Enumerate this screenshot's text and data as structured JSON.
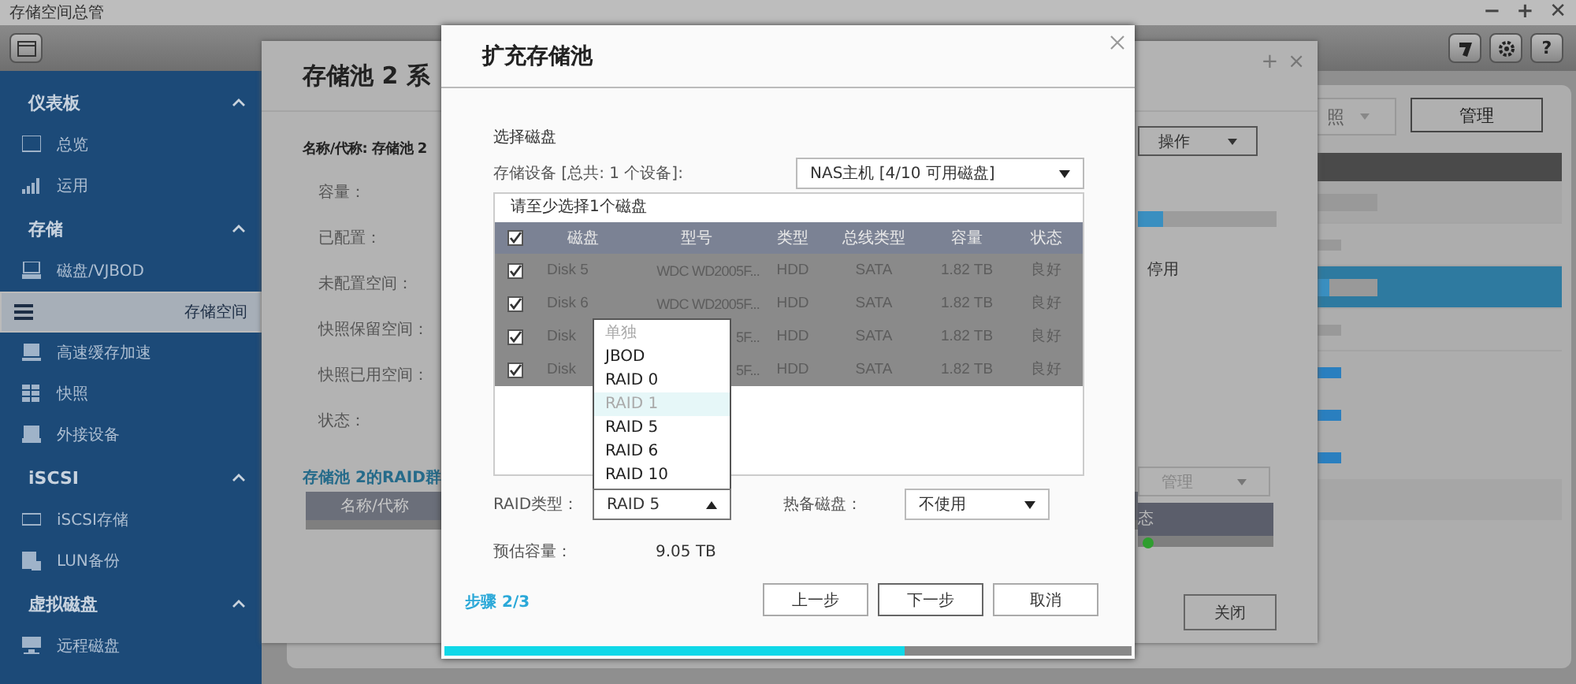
{
  "app": {
    "title": "存储空间总管",
    "window_controls": [
      "−",
      "+",
      "✕"
    ],
    "help_button": "?"
  },
  "sidebar": [
    {
      "title": "仪表板",
      "expanded": true,
      "items": [
        {
          "label": "总览",
          "selected": false
        },
        {
          "label": "运用",
          "selected": false
        }
      ]
    },
    {
      "title": "存储",
      "expanded": true,
      "items": [
        {
          "label": "磁盘/VJBOD",
          "selected": false
        },
        {
          "label": "存储空间",
          "selected": true
        },
        {
          "label": "高速缓存加速",
          "selected": false
        },
        {
          "label": "快照",
          "selected": false
        },
        {
          "label": "外接设备",
          "selected": false
        }
      ]
    },
    {
      "title": "iSCSI",
      "expanded": true,
      "items": [
        {
          "label": "iSCSI存储",
          "selected": false
        },
        {
          "label": "LUN备份",
          "selected": false
        }
      ]
    },
    {
      "title": "虚拟磁盘",
      "expanded": true,
      "items": [
        {
          "label": "远程磁盘",
          "selected": false
        }
      ]
    }
  ],
  "background_panel": {
    "snapshot_button": "照",
    "manage_button": "管理"
  },
  "pool_window": {
    "title": "存储池 2 系",
    "window_controls": [
      "+",
      "×"
    ],
    "name_line": "名称/代称: 存储池 2",
    "action_button": "操作",
    "fields": [
      "容量：",
      "已配置：",
      "未配置空间：",
      "快照保留空间：",
      "快照已用空间：",
      "状态："
    ],
    "usage": {
      "level": 0.18
    },
    "status_value": "停用",
    "raid_group_title": "存储池 2的RAID群",
    "raid_columns": [
      "名称/代称"
    ],
    "manage_button": "管理",
    "status_column": "态",
    "close_button": "关闭"
  },
  "dialog": {
    "title": "扩充存储池",
    "section": "选择磁盘",
    "device_label": "存储设备 [总共: 1 个设备]:",
    "device_value": "NAS主机 [4/10 可用磁盘]",
    "hint": "请至少选择1个磁盘",
    "all_checked": true,
    "columns": [
      "磁盘",
      "型号",
      "类型",
      "总线类型",
      "容量",
      "状态"
    ],
    "rows": [
      {
        "checked": true,
        "cells": [
          "Disk 5",
          "WDC WD2005F...",
          "HDD",
          "SATA",
          "1.82 TB",
          "良好"
        ]
      },
      {
        "checked": true,
        "cells": [
          "Disk 6",
          "WDC WD2005F...",
          "HDD",
          "SATA",
          "1.82 TB",
          "良好"
        ]
      },
      {
        "checked": true,
        "cells": [
          "Disk",
          "5F...",
          "HDD",
          "SATA",
          "1.82 TB",
          "良好"
        ]
      },
      {
        "checked": true,
        "cells": [
          "Disk",
          "5F...",
          "HDD",
          "SATA",
          "1.82 TB",
          "良好"
        ]
      }
    ],
    "raid_label": "RAID类型：",
    "raid_value": "RAID 5",
    "raid_open": true,
    "raid_options": [
      {
        "label": "单独",
        "disabled": true,
        "hovered": false
      },
      {
        "label": "JBOD",
        "disabled": false,
        "hovered": false
      },
      {
        "label": "RAID 0",
        "disabled": false,
        "hovered": false
      },
      {
        "label": "RAID 1",
        "disabled": true,
        "hovered": true
      },
      {
        "label": "RAID 5",
        "disabled": false,
        "hovered": false
      },
      {
        "label": "RAID 6",
        "disabled": false,
        "hovered": false
      },
      {
        "label": "RAID 10",
        "disabled": false,
        "hovered": false
      }
    ],
    "spare_label": "热备磁盘：",
    "spare_value": "不使用",
    "estimate_label": "预估容量：",
    "estimate_value": "9.05 TB",
    "buttons": [
      "上一步",
      "下一步",
      "取消"
    ],
    "step": "步骤 2/3",
    "progress": {
      "level": 0.67
    }
  }
}
